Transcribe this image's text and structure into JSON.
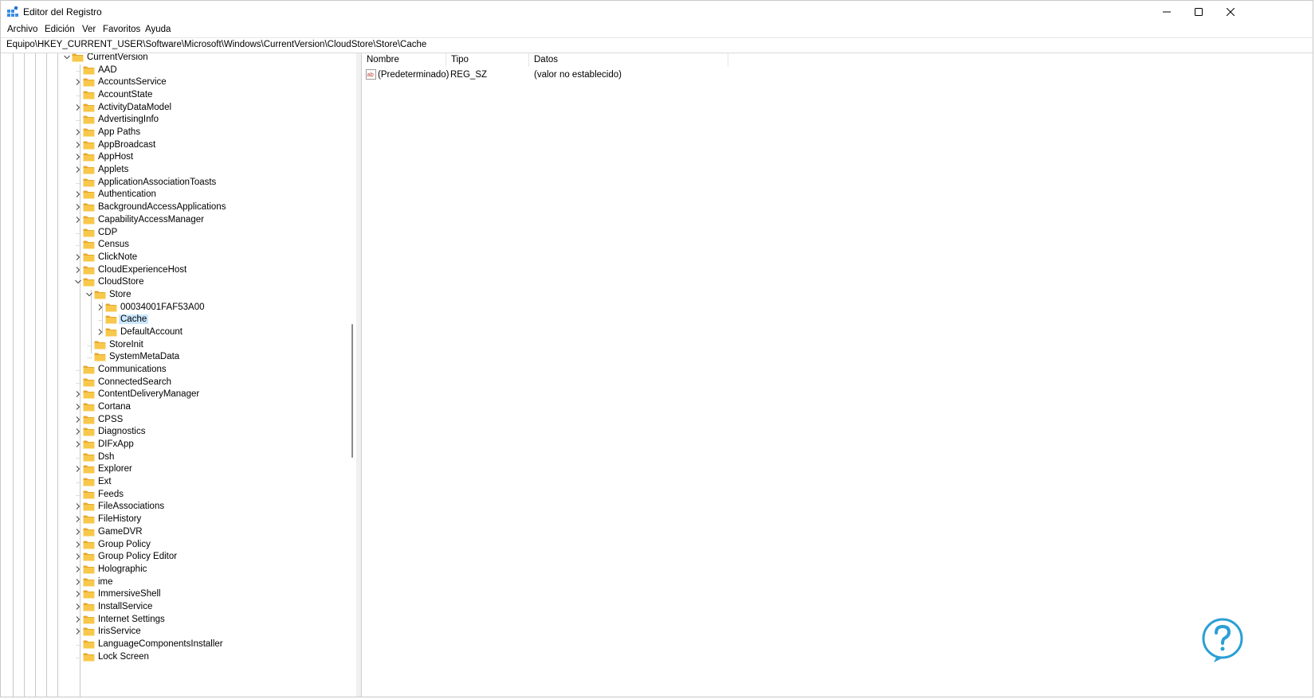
{
  "window": {
    "title": "Editor del Registro",
    "controls": [
      "minimize-icon",
      "maximize-icon",
      "close-icon"
    ]
  },
  "menu": [
    "Archivo",
    "Edición",
    "Ver",
    "Favoritos",
    "Ayuda"
  ],
  "address": "Equipo\\HKEY_CURRENT_USER\\Software\\Microsoft\\Windows\\CurrentVersion\\CloudStore\\Store\\Cache",
  "tree": [
    {
      "label": "CurrentVersion",
      "expander": "expanded"
    },
    {
      "label": "AAD",
      "expander": "none"
    },
    {
      "label": "AccountsService",
      "expander": "collapsed"
    },
    {
      "label": "AccountState",
      "expander": "none"
    },
    {
      "label": "ActivityDataModel",
      "expander": "collapsed"
    },
    {
      "label": "AdvertisingInfo",
      "expander": "none"
    },
    {
      "label": "App Paths",
      "expander": "collapsed"
    },
    {
      "label": "AppBroadcast",
      "expander": "collapsed"
    },
    {
      "label": "AppHost",
      "expander": "collapsed"
    },
    {
      "label": "Applets",
      "expander": "collapsed"
    },
    {
      "label": "ApplicationAssociationToasts",
      "expander": "none"
    },
    {
      "label": "Authentication",
      "expander": "collapsed"
    },
    {
      "label": "BackgroundAccessApplications",
      "expander": "collapsed"
    },
    {
      "label": "CapabilityAccessManager",
      "expander": "collapsed"
    },
    {
      "label": "CDP",
      "expander": "none"
    },
    {
      "label": "Census",
      "expander": "none"
    },
    {
      "label": "ClickNote",
      "expander": "collapsed"
    },
    {
      "label": "CloudExperienceHost",
      "expander": "collapsed"
    },
    {
      "label": "CloudStore",
      "expander": "expanded"
    },
    {
      "label": "Store",
      "expander": "expanded"
    },
    {
      "label": "00034001FAF53A00",
      "expander": "collapsed"
    },
    {
      "label": "Cache",
      "expander": "none",
      "selected": true
    },
    {
      "label": "DefaultAccount",
      "expander": "collapsed"
    },
    {
      "label": "StoreInit",
      "expander": "none"
    },
    {
      "label": "SystemMetaData",
      "expander": "none"
    },
    {
      "label": "Communications",
      "expander": "none"
    },
    {
      "label": "ConnectedSearch",
      "expander": "none"
    },
    {
      "label": "ContentDeliveryManager",
      "expander": "collapsed"
    },
    {
      "label": "Cortana",
      "expander": "collapsed"
    },
    {
      "label": "CPSS",
      "expander": "collapsed"
    },
    {
      "label": "Diagnostics",
      "expander": "collapsed"
    },
    {
      "label": "DIFxApp",
      "expander": "collapsed"
    },
    {
      "label": "Dsh",
      "expander": "none"
    },
    {
      "label": "Explorer",
      "expander": "collapsed"
    },
    {
      "label": "Ext",
      "expander": "none"
    },
    {
      "label": "Feeds",
      "expander": "none"
    },
    {
      "label": "FileAssociations",
      "expander": "collapsed"
    },
    {
      "label": "FileHistory",
      "expander": "collapsed"
    },
    {
      "label": "GameDVR",
      "expander": "collapsed"
    },
    {
      "label": "Group Policy",
      "expander": "collapsed"
    },
    {
      "label": "Group Policy Editor",
      "expander": "collapsed"
    },
    {
      "label": "Holographic",
      "expander": "collapsed"
    },
    {
      "label": "ime",
      "expander": "collapsed"
    },
    {
      "label": "ImmersiveShell",
      "expander": "collapsed"
    },
    {
      "label": "InstallService",
      "expander": "collapsed"
    },
    {
      "label": "Internet Settings",
      "expander": "collapsed"
    },
    {
      "label": "IrisService",
      "expander": "collapsed"
    },
    {
      "label": "LanguageComponentsInstaller",
      "expander": "none"
    },
    {
      "label": "Lock Screen",
      "expander": "none"
    }
  ],
  "values_list": {
    "headers": {
      "name": "Nombre",
      "type": "Tipo",
      "data": "Datos"
    },
    "rows": [
      {
        "icon": "string-value-icon",
        "name": "(Predeterminado)",
        "type": "REG_SZ",
        "data": "(valor no establecido)"
      }
    ]
  },
  "colors": {
    "folder": "#f8c84b",
    "folder_dark": "#e7a82a",
    "selection": "#cce8ff",
    "accent": "#0a64c8",
    "watermark": "#2a9fd6"
  }
}
